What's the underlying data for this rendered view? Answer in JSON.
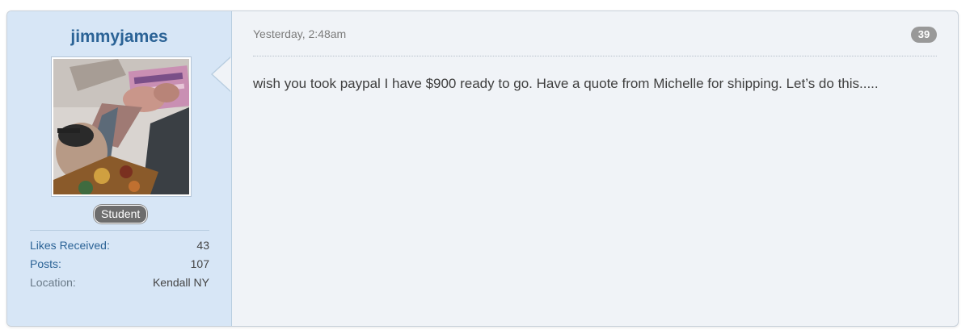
{
  "post": {
    "author": {
      "username": "jimmyjames",
      "role": "Student",
      "avatar_icon": "user-avatar-photo",
      "stats": [
        {
          "label": "Likes Received:",
          "value": "43"
        },
        {
          "label": "Posts:",
          "value": "107"
        },
        {
          "label": "Location:",
          "value": "Kendall NY"
        }
      ]
    },
    "timestamp": "Yesterday, 2:48am",
    "post_number": "39",
    "message": "wish you took paypal I have $900 ready to go. Have a quote from Michelle for shipping. Let’s do this.....",
    "colors": {
      "sidebar_bg": "#d7e6f6",
      "content_bg": "#f0f3f7",
      "username": "#2b6396",
      "badge_bg": "#6d6d6d",
      "post_number_bg": "#999999"
    }
  }
}
